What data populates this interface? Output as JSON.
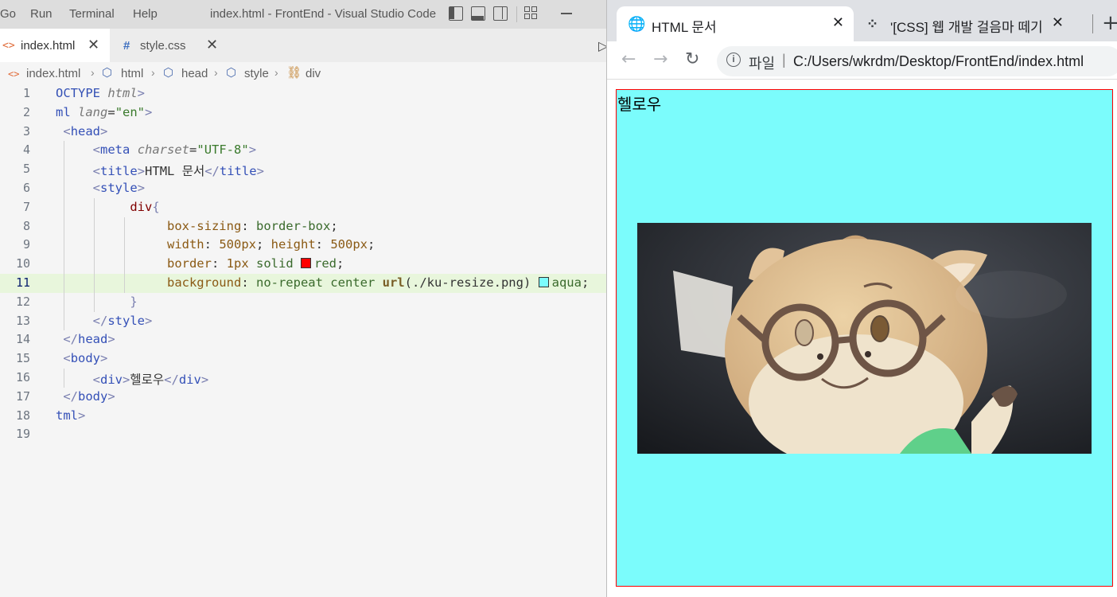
{
  "vscode": {
    "menu": [
      "Go",
      "Run",
      "Terminal",
      "Help"
    ],
    "window_title": "index.html - FrontEnd - Visual Studio Code",
    "tabs": [
      {
        "icon": "<>",
        "label": "index.html",
        "close": "✕"
      },
      {
        "icon": "#",
        "label": "style.css",
        "close": "✕"
      }
    ],
    "breadcrumb": [
      "index.html",
      "html",
      "head",
      "style",
      "div"
    ],
    "line_numbers": [
      "1",
      "2",
      "3",
      "4",
      "5",
      "6",
      "7",
      "8",
      "9",
      "10",
      "11",
      "12",
      "13",
      "14",
      "15",
      "16",
      "17",
      "18",
      "19"
    ],
    "current_line": "11"
  },
  "chrome": {
    "tabs": [
      {
        "label": "HTML 문서",
        "close": "✕"
      },
      {
        "label": "'[CSS] 웹 개발 걸음마 떼기",
        "close": "✕"
      }
    ],
    "new_tab": "+",
    "address": {
      "scheme": "파일",
      "sep": "|",
      "url": "C:/Users/wkrdm/Desktop/FrontEnd/index.html"
    },
    "page": {
      "div_text": "헬로우"
    },
    "colors": {
      "div_border": "#ff0000",
      "div_background": "#7bfcfc"
    }
  }
}
